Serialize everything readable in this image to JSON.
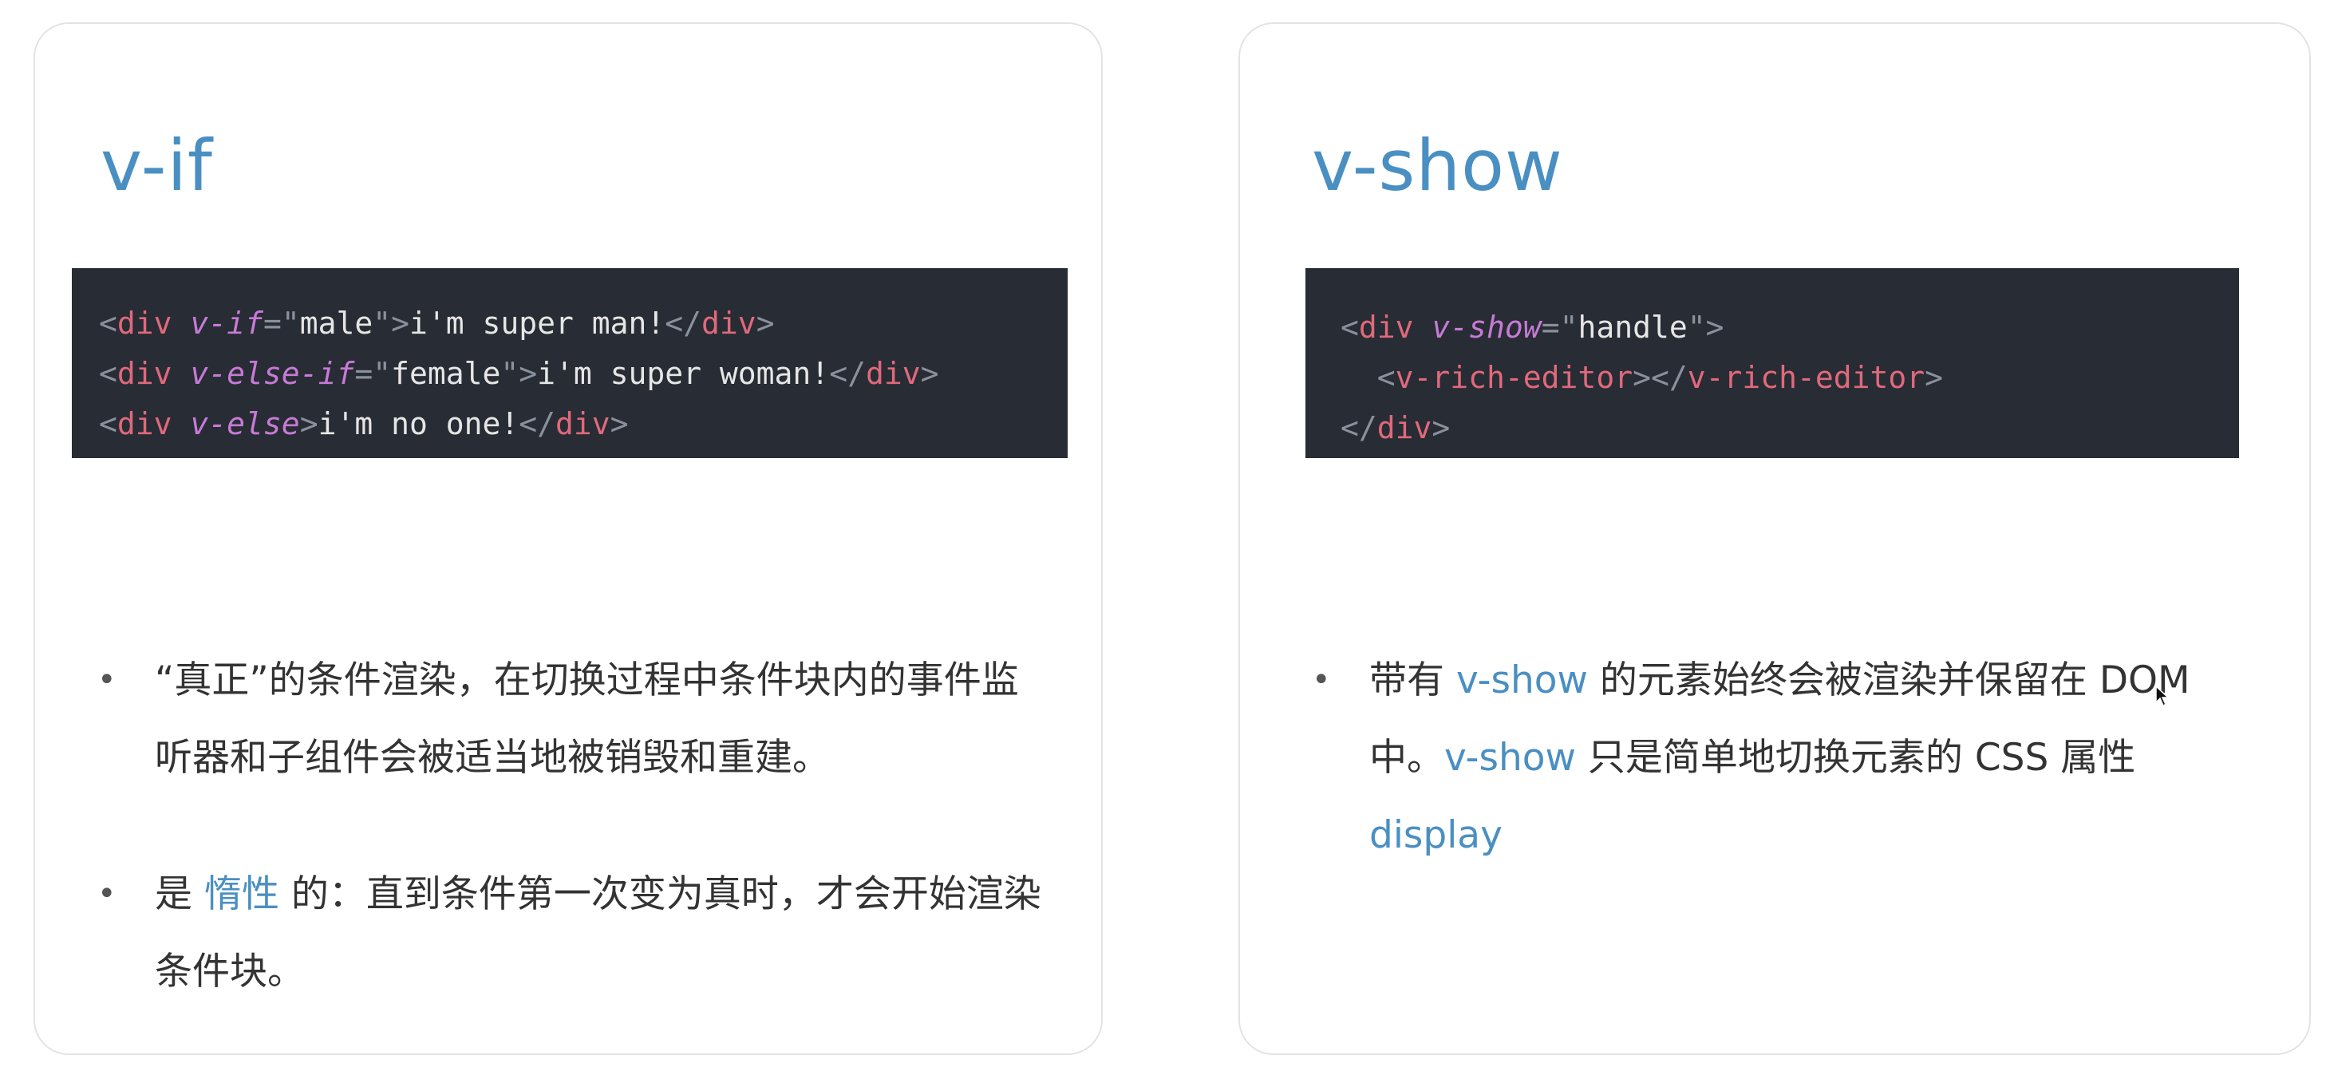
{
  "left_card": {
    "title": "v-if",
    "code_lines": [
      [
        {
          "k": "p",
          "t": "<"
        },
        {
          "k": "t",
          "t": "div"
        },
        {
          "k": "s",
          "t": " "
        },
        {
          "k": "a",
          "t": "v-if"
        },
        {
          "k": "p",
          "t": "=\""
        },
        {
          "k": "s",
          "t": "male"
        },
        {
          "k": "p",
          "t": "\">"
        },
        {
          "k": "s",
          "t": "i'm super man!"
        },
        {
          "k": "p",
          "t": "</"
        },
        {
          "k": "t",
          "t": "div"
        },
        {
          "k": "p",
          "t": ">"
        }
      ],
      [
        {
          "k": "p",
          "t": "<"
        },
        {
          "k": "t",
          "t": "div"
        },
        {
          "k": "s",
          "t": " "
        },
        {
          "k": "a",
          "t": "v-else-if"
        },
        {
          "k": "p",
          "t": "=\""
        },
        {
          "k": "s",
          "t": "female"
        },
        {
          "k": "p",
          "t": "\">"
        },
        {
          "k": "s",
          "t": "i'm super woman!"
        },
        {
          "k": "p",
          "t": "</"
        },
        {
          "k": "t",
          "t": "div"
        },
        {
          "k": "p",
          "t": ">"
        }
      ],
      [
        {
          "k": "p",
          "t": "<"
        },
        {
          "k": "t",
          "t": "div"
        },
        {
          "k": "s",
          "t": " "
        },
        {
          "k": "a",
          "t": "v-else"
        },
        {
          "k": "p",
          "t": ">"
        },
        {
          "k": "s",
          "t": "i'm no one!"
        },
        {
          "k": "p",
          "t": "</"
        },
        {
          "k": "t",
          "t": "div"
        },
        {
          "k": "p",
          "t": ">"
        }
      ]
    ],
    "bullets": [
      {
        "marker": "•",
        "parts": [
          {
            "text": "“真正”的条件渲染，在切换过程中条件块内的事件监听器和子组件会被适当地被销毁和重建。",
            "highlight": false
          }
        ]
      },
      {
        "marker": "•",
        "parts": [
          {
            "text": "是 ",
            "highlight": false
          },
          {
            "text": "惰性",
            "highlight": true
          },
          {
            "text": " 的：直到条件第一次变为真时，才会开始渲染条件块。",
            "highlight": false
          }
        ]
      }
    ]
  },
  "right_card": {
    "title": "v-show",
    "code_lines": [
      [
        {
          "k": "p",
          "t": "<"
        },
        {
          "k": "t",
          "t": "div"
        },
        {
          "k": "s",
          "t": " "
        },
        {
          "k": "a",
          "t": "v-show"
        },
        {
          "k": "p",
          "t": "=\""
        },
        {
          "k": "s",
          "t": "handle"
        },
        {
          "k": "p",
          "t": "\">"
        }
      ],
      [
        {
          "k": "s",
          "t": "  "
        },
        {
          "k": "p",
          "t": "<"
        },
        {
          "k": "t",
          "t": "v-rich-editor"
        },
        {
          "k": "p",
          "t": "></"
        },
        {
          "k": "t",
          "t": "v-rich-editor"
        },
        {
          "k": "p",
          "t": ">"
        }
      ],
      [
        {
          "k": "p",
          "t": "</"
        },
        {
          "k": "t",
          "t": "div"
        },
        {
          "k": "p",
          "t": ">"
        }
      ]
    ],
    "bullets": [
      {
        "marker": "•",
        "parts": [
          {
            "text": "带有 ",
            "highlight": false
          },
          {
            "text": "v-show",
            "highlight": true
          },
          {
            "text": " 的元素始终会被渲染并保留在 DOM 中。",
            "highlight": false
          },
          {
            "text": "v-show",
            "highlight": true
          },
          {
            "text": " 只是简单地切换元素的 CSS 属性 ",
            "highlight": false
          },
          {
            "text": "display",
            "highlight": true
          }
        ]
      }
    ]
  },
  "colors": {
    "accent": "#4a8fc2",
    "code_background": "#282c34",
    "tag": "#e0697b",
    "attribute": "#c77ad6",
    "punctuation": "#8a919c",
    "body_text": "#333333"
  },
  "icons": {
    "cursor": "mouse-pointer-icon"
  }
}
